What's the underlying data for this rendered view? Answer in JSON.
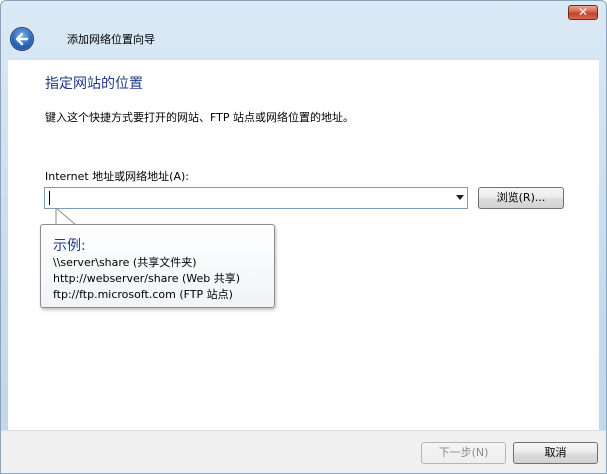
{
  "window": {
    "title": "添加网络位置向导",
    "close_symbol": "✕",
    "close_icon": "close-icon",
    "back_icon": "back-arrow-icon"
  },
  "page": {
    "heading": "指定网站的位置",
    "instruction": "键入这个快捷方式要打开的网站、FTP 站点或网络位置的地址。"
  },
  "address": {
    "label": "Internet 地址或网络地址(A):",
    "value": "",
    "dropdown_icon": "chevron-down-icon",
    "browse_label": "浏览(R)..."
  },
  "tooltip": {
    "heading": "示例:",
    "lines": [
      "\\\\server\\share   (共享文件夹)",
      "http://webserver/share   (Web 共享)",
      "ftp://ftp.microsoft.com   (FTP 站点)"
    ]
  },
  "footer": {
    "next_label": "下一步(N)",
    "next_enabled": false,
    "cancel_label": "取消"
  },
  "colors": {
    "heading_blue": "#1e3a8a",
    "titlebar_gradient_top": "#dbe9f5",
    "titlebar_gradient_bottom": "#c1d6ea",
    "close_red": "#c2412a"
  }
}
